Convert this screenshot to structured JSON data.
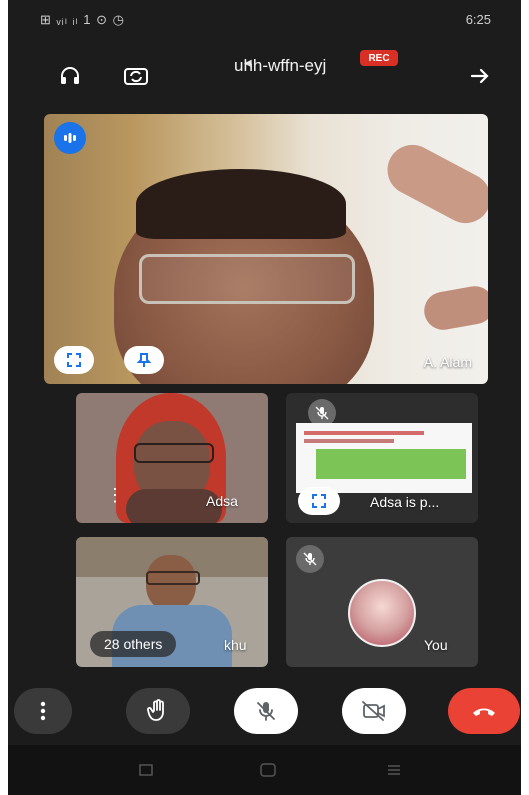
{
  "status_bar": {
    "left": "⊞ ᵥᵢₗ ᵢₗ 1 ⊙ ◷",
    "time": "6:25"
  },
  "header": {
    "meeting_code": "uhh-wffn-eyj",
    "rec_label": "REC"
  },
  "main_tile": {
    "name": "A. Alam"
  },
  "tiles": [
    {
      "name": "Adsa"
    },
    {
      "name": "Adsa is p..."
    },
    {
      "name": "khu",
      "others_label": "28 others"
    },
    {
      "name": "You"
    }
  ],
  "colors": {
    "background": "#1c1c1c",
    "rec": "#d93025",
    "end_call": "#ea4335",
    "badge_blue": "#1a73e8"
  },
  "icons": [
    "headphones-icon",
    "camera-switch-icon",
    "back-arrow-icon",
    "audio-level-icon",
    "fullscreen-icon",
    "pin-icon",
    "mic-off-icon",
    "more-icon",
    "raise-hand-icon",
    "camera-off-icon",
    "end-call-icon"
  ]
}
